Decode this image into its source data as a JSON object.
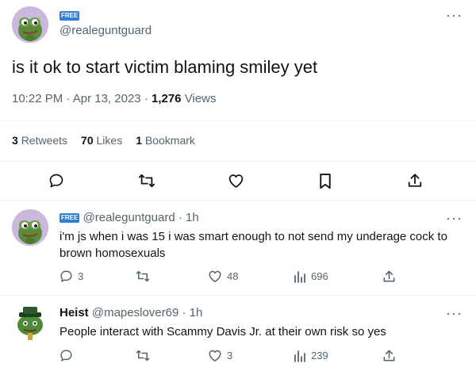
{
  "main_tweet": {
    "badge": "FREE",
    "handle": "@realeguntguard",
    "text": "is it ok to start victim blaming smiley yet",
    "time": "10:22 PM",
    "date": "Apr 13, 2023",
    "views_count": "1,276",
    "views_label": "Views",
    "stats": [
      {
        "count": "3",
        "label": "Retweets"
      },
      {
        "count": "70",
        "label": "Likes"
      },
      {
        "count": "1",
        "label": "Bookmark"
      }
    ],
    "icons": [
      "reply-icon",
      "retweet-icon",
      "like-icon",
      "bookmark-icon",
      "share-icon"
    ]
  },
  "replies": [
    {
      "badge": "FREE",
      "display_name": "",
      "handle": "@realeguntguard",
      "age": "1h",
      "text_line1": "i'm js when i was 15 i was smart enough to not send my underage cock to",
      "text_line2": "brown homosexuals",
      "reply_count": "3",
      "retweet_count": "",
      "like_count": "48",
      "view_count": "696"
    },
    {
      "badge": "",
      "display_name": "Heist",
      "handle": "@mapeslover69",
      "age": "1h",
      "text_line1": "People interact with Scammy Davis Jr. at their own risk so yes",
      "text_line2": "",
      "reply_count": "",
      "retweet_count": "",
      "like_count": "3",
      "view_count": "239"
    }
  ],
  "more_glyph": "···",
  "separator": "·",
  "colors": {
    "badge": "#2f7fd8",
    "muted": "#536471",
    "text": "#0f1419",
    "divider": "#eff3f4"
  }
}
